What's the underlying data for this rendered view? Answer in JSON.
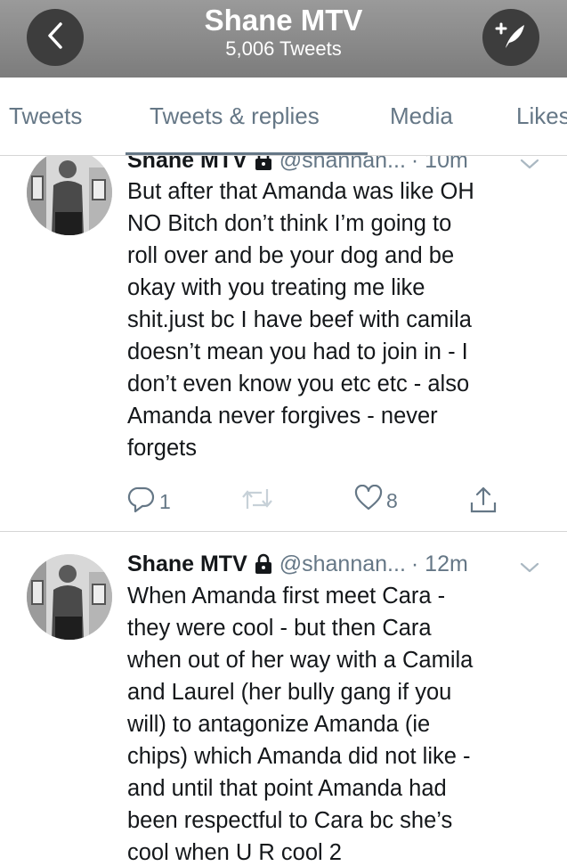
{
  "header": {
    "title": "Shane MTV",
    "subtitle": "5,006 Tweets",
    "back_icon": "chevron-left-icon",
    "compose_icon": "compose-feather-icon"
  },
  "tabs": [
    {
      "label": "Tweets",
      "active": false
    },
    {
      "label": "Tweets & replies",
      "active": true
    },
    {
      "label": "Media",
      "active": false
    },
    {
      "label": "Likes",
      "active": false
    }
  ],
  "tweets": [
    {
      "name": "Shane MTV",
      "handle": "@shannan...",
      "time": "· 10m",
      "protected": true,
      "text": "But after that Amanda was like OH\nNO Bitch don’t think I’m going to\nroll over and be your dog and be\nokay with you treating me like\nshit.just bc I have beef with camila\ndoesn’t mean you had to join in - I\ndon’t even know you etc etc - also\nAmanda never forgives - never\nforgets",
      "reply_count": "1",
      "retweet_count": "",
      "like_count": "8"
    },
    {
      "name": "Shane MTV",
      "handle": "@shannan...",
      "time": "· 12m",
      "protected": true,
      "text": "When Amanda first meet Cara -\nthey were cool - but then Cara\nwhen out of her way with a Camila\nand Laurel (her bully gang if you\nwill) to antagonize Amanda (ie\nchips) which Amanda did not like -\nand until that point Amanda had\nbeen respectful to Cara bc she’s\ncool when U R cool 2"
    }
  ],
  "colors": {
    "header_bg": "#8a8a8a",
    "header_button": "#3d3d3d",
    "secondary_text": "#657786",
    "primary_text": "#14171a"
  }
}
